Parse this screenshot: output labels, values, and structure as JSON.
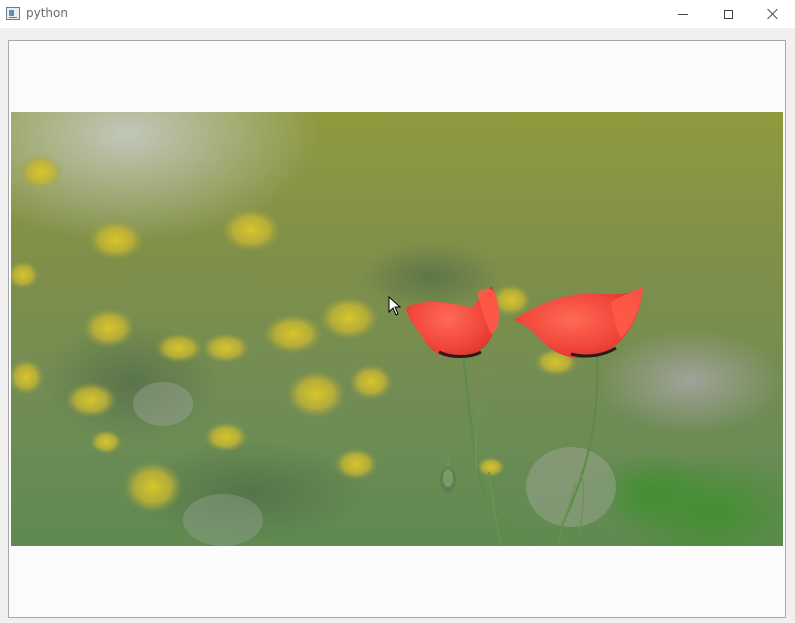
{
  "window": {
    "title": "python",
    "minimize_icon": "minimize-icon",
    "maximize_icon": "maximize-icon",
    "close_icon": "close-icon",
    "app_icon": "python-app-icon"
  },
  "content": {
    "image_subject": "two red poppies"
  },
  "colors": {
    "titlebar": "#ffffff",
    "frame_border": "#a8a8a8",
    "frame_bg": "#fbfbfb",
    "poppy": "#f0483a"
  }
}
